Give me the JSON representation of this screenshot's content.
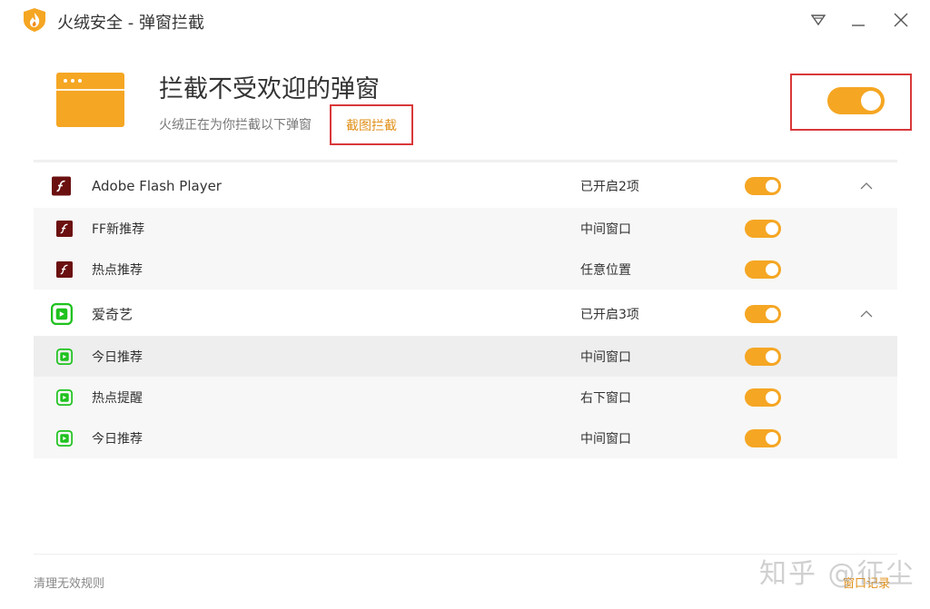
{
  "window": {
    "title": "火绒安全 - 弹窗拦截",
    "logo_icon": "flame-shield-icon",
    "menu_icon": "triangle-down-icon",
    "minimize_icon": "minimize-icon",
    "close_icon": "close-icon"
  },
  "header": {
    "title": "拦截不受欢迎的弹窗",
    "subtitle": "火绒正在为你拦截以下弹窗",
    "capture_link": "截图拦截",
    "master_toggle_on": true,
    "icon": "popup-window-icon"
  },
  "groups": [
    {
      "name": "Adobe Flash Player",
      "status": "已开启2项",
      "icon": "flash-icon",
      "expanded": true,
      "items": [
        {
          "name": "FF新推荐",
          "position": "中间窗口",
          "enabled": true
        },
        {
          "name": "热点推荐",
          "position": "任意位置",
          "enabled": true
        }
      ]
    },
    {
      "name": "爱奇艺",
      "status": "已开启3项",
      "icon": "iqiyi-icon",
      "expanded": true,
      "items": [
        {
          "name": "今日推荐",
          "position": "中间窗口",
          "enabled": true
        },
        {
          "name": "热点提醒",
          "position": "右下窗口",
          "enabled": true
        },
        {
          "name": "今日推荐",
          "position": "中间窗口",
          "enabled": true
        }
      ]
    }
  ],
  "footer": {
    "clear_rules": "清理无效规则",
    "window_log": "窗口记录",
    "watermark": "知乎 @征尘"
  },
  "colors": {
    "accent": "#f5a623",
    "link": "#e0901a",
    "highlight_box": "#d9383a",
    "flash": "#6b1010",
    "iqiyi": "#1fc21f"
  }
}
